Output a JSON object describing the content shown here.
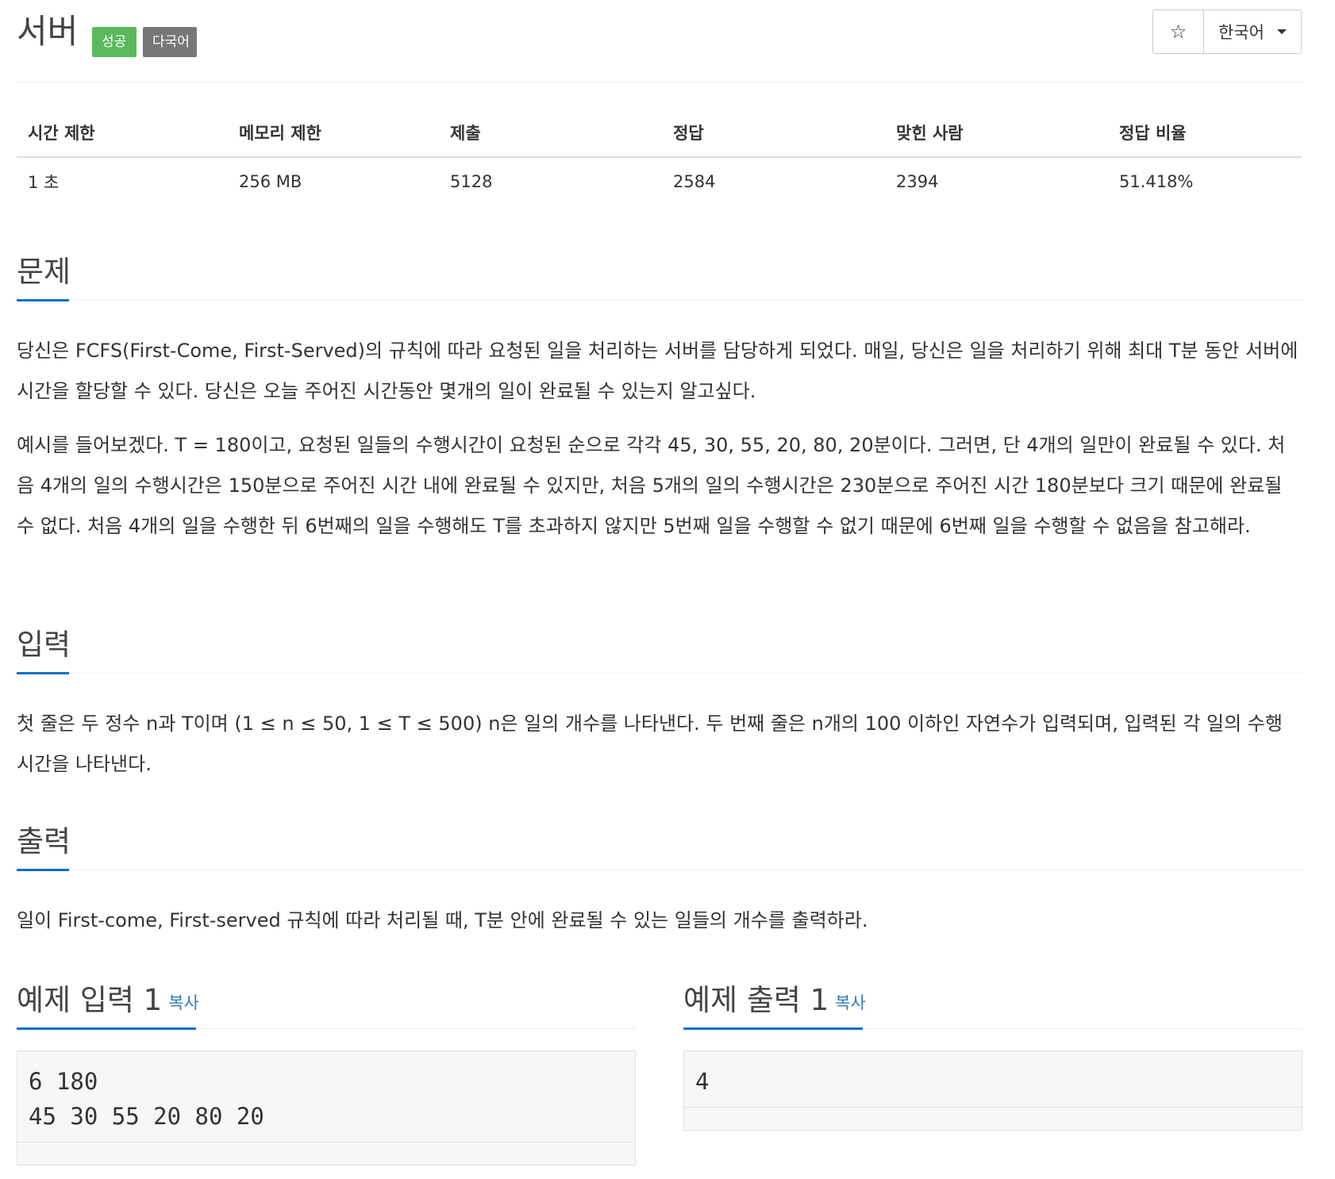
{
  "problem": {
    "title": "서버",
    "labels": {
      "success": "성공",
      "multilang": "다국어"
    },
    "star_icon": "☆",
    "language_select": "한국어"
  },
  "info_table": {
    "headers": [
      "시간 제한",
      "메모리 제한",
      "제출",
      "정답",
      "맞힌 사람",
      "정답 비율"
    ],
    "values": [
      "1 초",
      "256 MB",
      "5128",
      "2584",
      "2394",
      "51.418%"
    ]
  },
  "sections": {
    "description": {
      "heading": "문제",
      "paragraphs": [
        "당신은 FCFS(First-Come, First-Served)의 규칙에 따라 요청된 일을 처리하는 서버를 담당하게 되었다. 매일, 당신은 일을 처리하기 위해 최대 T분 동안 서버에 시간을 할당할 수 있다. 당신은 오늘 주어진 시간동안 몇개의 일이 완료될 수 있는지 알고싶다.",
        "예시를 들어보겠다. T = 180이고, 요청된 일들의 수행시간이 요청된 순으로 각각 45, 30, 55, 20, 80, 20분이다. 그러면, 단 4개의 일만이 완료될 수 있다. 처음 4개의 일의 수행시간은 150분으로 주어진 시간 내에 완료될 수 있지만, 처음 5개의 일의 수행시간은 230분으로 주어진 시간 180분보다 크기 때문에 완료될 수 없다. 처음 4개의 일을 수행한 뒤 6번째의 일을 수행해도 T를 초과하지 않지만 5번째 일을 수행할 수 없기 때문에 6번째 일을 수행할 수 없음을 참고해라."
      ]
    },
    "input": {
      "heading": "입력",
      "text": "첫 줄은 두 정수 n과 T이며 (1 ≤ n ≤ 50, 1 ≤ T ≤ 500) n은 일의 개수를 나타낸다. 두 번째 줄은 n개의 100 이하인 자연수가 입력되며, 입력된 각 일의 수행 시간을 나타낸다."
    },
    "output": {
      "heading": "출력",
      "text": "일이 First-come, First-served 규칙에 따라 처리될 때, T분 안에 완료될 수 있는 일들의 개수를 출력하라."
    }
  },
  "samples": {
    "input": {
      "heading": "예제 입력 1",
      "copy": "복사",
      "content": "6 180\n45 30 55 20 80 20"
    },
    "output": {
      "heading": "예제 출력 1",
      "copy": "복사",
      "content": "4"
    }
  }
}
